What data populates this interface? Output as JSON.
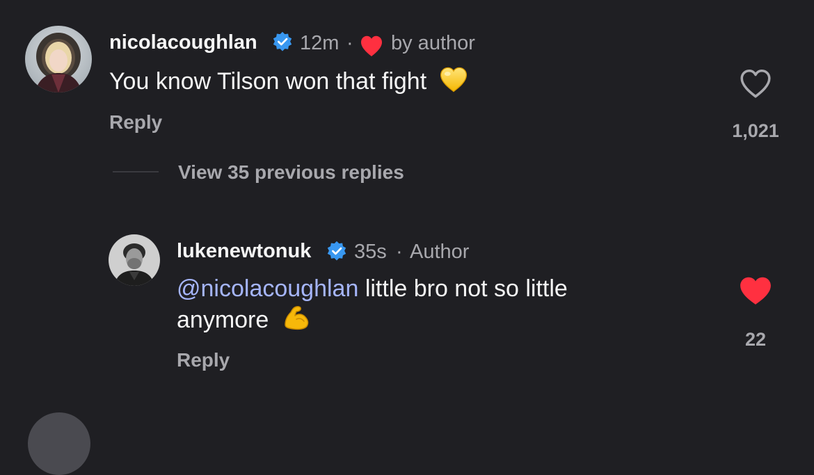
{
  "comment": {
    "username": "nicolacoughlan",
    "time": "12m",
    "separator": "·",
    "liked_by_label": "by author",
    "text": "You know Tilson won that fight",
    "reply_label": "Reply",
    "like_count": "1,021",
    "liked": false
  },
  "view_replies_label": "View 35 previous replies",
  "reply": {
    "username": "lukenewtonuk",
    "time": "35s",
    "separator": "·",
    "author_label": "Author",
    "mention": "@nicolacoughlan",
    "text_line1": "little bro not so little",
    "text_line2": "anymore",
    "reply_label": "Reply",
    "like_count": "22",
    "liked": true
  },
  "colors": {
    "background": "#1f1f23",
    "verified": "#3897f0",
    "like_red": "#ff3040",
    "mention": "#a5b5fb",
    "secondary_text": "#a8a8ad"
  }
}
